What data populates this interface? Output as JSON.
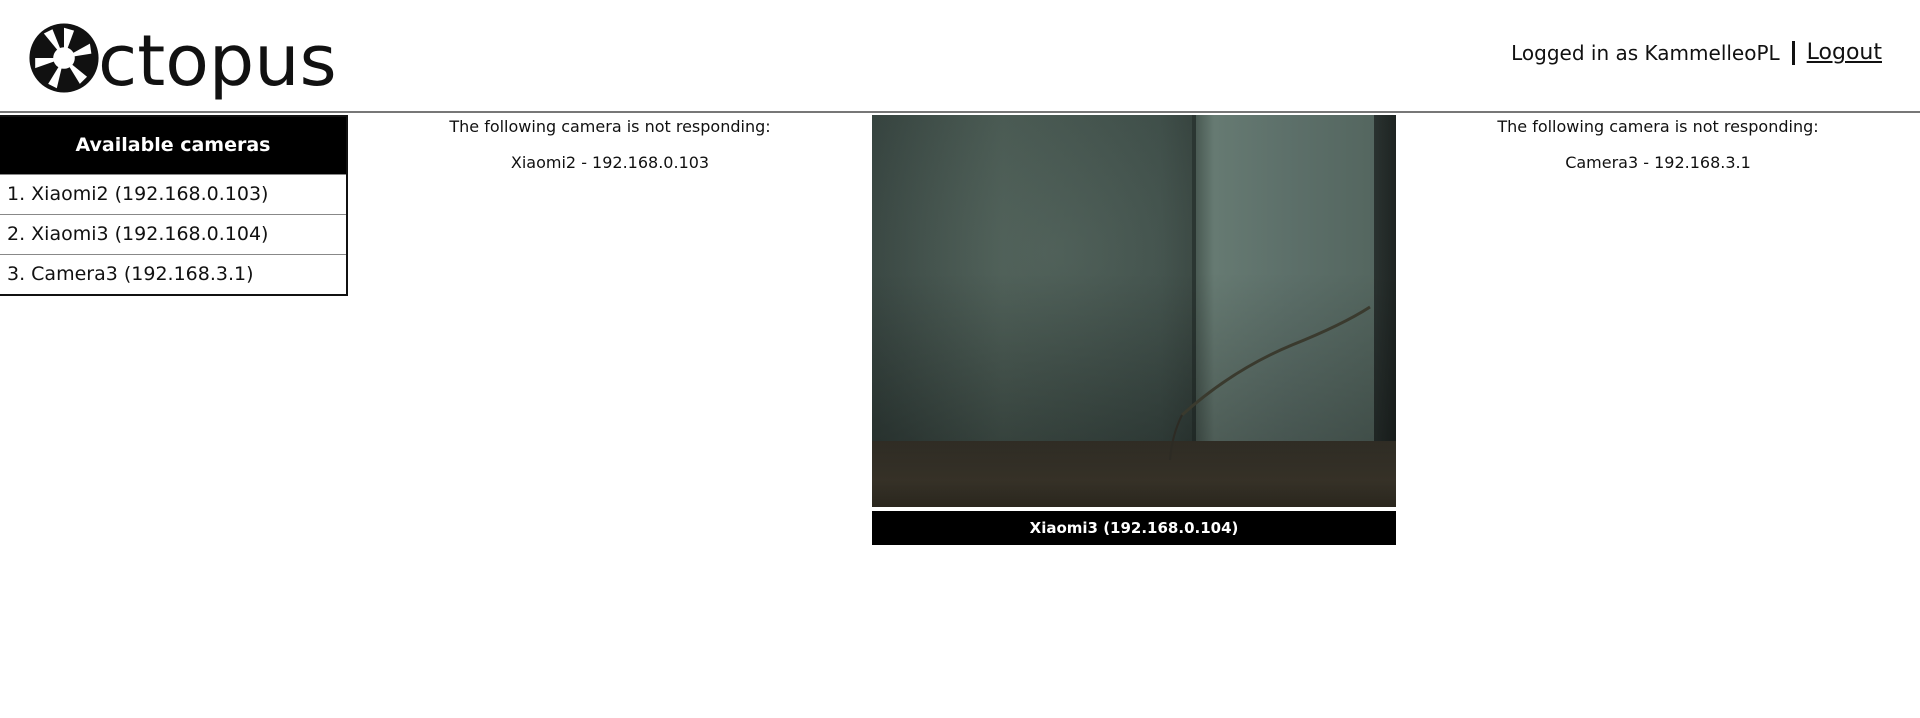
{
  "header": {
    "logo_text": "Octopus",
    "logo_word": "ctopus",
    "logged_in_text": "Logged in as KammelleoPL",
    "logout_label": "Logout"
  },
  "sidebar": {
    "title": "Available cameras",
    "items": [
      {
        "label": "1. Xiaomi2 (192.168.0.103)"
      },
      {
        "label": "2. Xiaomi3 (192.168.0.104)"
      },
      {
        "label": "3. Camera3 (192.168.3.1)"
      }
    ]
  },
  "panels": [
    {
      "status": "not-responding",
      "message": "The following camera is not responding:",
      "camera": "Xiaomi2 - 192.168.0.103"
    },
    {
      "status": "streaming",
      "caption": "Xiaomi3 (192.168.0.104)"
    },
    {
      "status": "not-responding",
      "message": "The following camera is not responding:",
      "camera": "Camera3 - 192.168.3.1"
    }
  ],
  "colors": {
    "background": "#ffffff",
    "text": "#111111",
    "header_bar": "#000000",
    "divider": "#777777"
  },
  "icons": {
    "logo": "aperture-logo-icon"
  }
}
